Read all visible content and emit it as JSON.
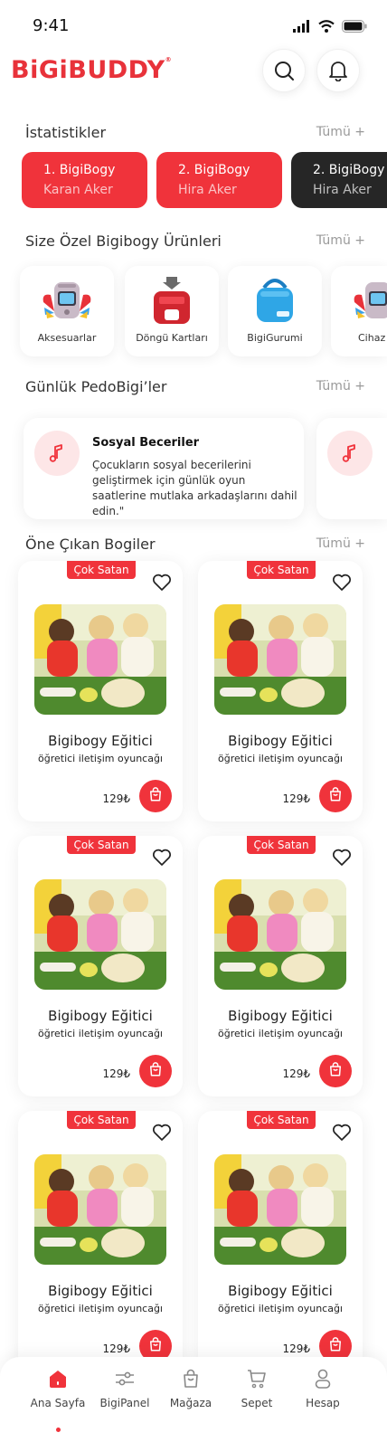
{
  "status_bar": {
    "time": "9:41"
  },
  "brand": {
    "logo": "BiGiBUDDY",
    "reg": "®",
    "accent": "#f0333b"
  },
  "sections": {
    "stats": {
      "title": "İstatistikler",
      "all": "Tümü +"
    },
    "products": {
      "title": "Size Özel Bigibogy Ürünleri",
      "all": "Tümü +"
    },
    "tips": {
      "title": "Günlük PedoBigi’ler",
      "all": "Tümü +"
    },
    "featured": {
      "title": "Öne Çıkan Bogiler",
      "all": "Tümü +"
    }
  },
  "stat_cards": [
    {
      "rank": "1.  BigiBogy",
      "name": "Karan Aker"
    },
    {
      "rank": "2.  BigiBogy",
      "name": "Hira Aker"
    },
    {
      "rank": "2.  BigiBogy",
      "name": "Hira Aker"
    }
  ],
  "product_tiles": [
    {
      "label": "Aksesuarlar"
    },
    {
      "label": "Döngü Kartları"
    },
    {
      "label": "BigiGurumi"
    },
    {
      "label": "Cihaz"
    }
  ],
  "tips": [
    {
      "title": "Sosyal Beceriler",
      "text": "Çocukların sosyal becerilerini geliştirmek için günlük oyun saatlerine mutlaka arkadaşlarını dahil edin.\""
    }
  ],
  "featured_items": [
    {
      "badge": "Çok Satan",
      "title": "Bigibogy Eğitici",
      "subtitle": "öğretici iletişim oyuncağı",
      "price": "129₺"
    },
    {
      "badge": "Çok Satan",
      "title": "Bigibogy Eğitici",
      "subtitle": "öğretici iletişim oyuncağı",
      "price": "129₺"
    },
    {
      "badge": "Çok Satan",
      "title": "Bigibogy Eğitici",
      "subtitle": "öğretici iletişim oyuncağı",
      "price": "129₺"
    },
    {
      "badge": "Çok Satan",
      "title": "Bigibogy Eğitici",
      "subtitle": "öğretici iletişim oyuncağı",
      "price": "129₺"
    },
    {
      "badge": "Çok Satan",
      "title": "Bigibogy Eğitici",
      "subtitle": "öğretici iletişim oyuncağı",
      "price": "129₺"
    },
    {
      "badge": "Çok Satan",
      "title": "Bigibogy Eğitici",
      "subtitle": "öğretici iletişim oyuncağı",
      "price": "129₺"
    }
  ],
  "tabbar": {
    "items": [
      {
        "label": "Ana Sayfa",
        "icon": "home-icon",
        "active": true
      },
      {
        "label": "BigiPanel",
        "icon": "sliders-icon"
      },
      {
        "label": "Mağaza",
        "icon": "shopping-bag-icon"
      },
      {
        "label": "Sepet",
        "icon": "cart-icon"
      },
      {
        "label": "Hesap",
        "icon": "user-icon"
      }
    ]
  }
}
